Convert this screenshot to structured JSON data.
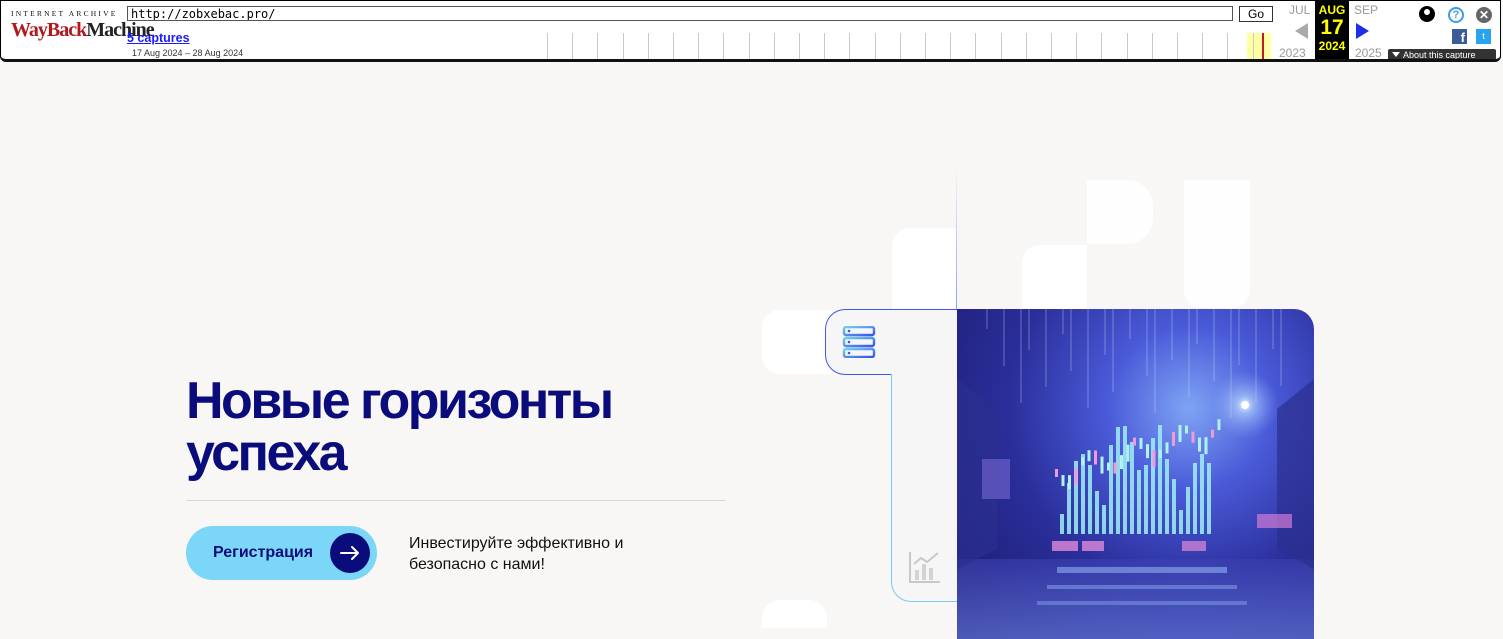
{
  "wayback": {
    "logo_top": "INTERNET ARCHIVE",
    "logo_word_1": "WayBack",
    "logo_word_2": "Machine",
    "url": "http://zobxebac.pro/",
    "go_label": "Go",
    "captures_label": "5 captures",
    "date_range": "17 Aug 2024 – 28 Aug 2024",
    "prev_month": "JUL",
    "prev_year": "2023",
    "current_month": "AUG",
    "current_day": "17",
    "current_year": "2024",
    "next_month": "SEP",
    "next_year": "2025",
    "about_label": "About this capture",
    "facebook_glyph": "f",
    "twitter_glyph": "t",
    "help_glyph": "?",
    "close_glyph": "✕"
  },
  "hero": {
    "title_line_1": "Новые горизонты",
    "title_line_2": "успеха",
    "cta_label": "Регистрация",
    "tagline": "Инвестируйте эффективно и безопасно с нами!"
  },
  "colors": {
    "brand_navy": "#0b0c7c",
    "cta_background": "#7cd6f8",
    "card_border": "#4257e8",
    "page_background": "#f8f7f5"
  },
  "icons": {
    "card_icon_1": "server-stack-icon",
    "card_icon_2": "chart-icon",
    "cta_icon": "arrow-right-icon"
  }
}
